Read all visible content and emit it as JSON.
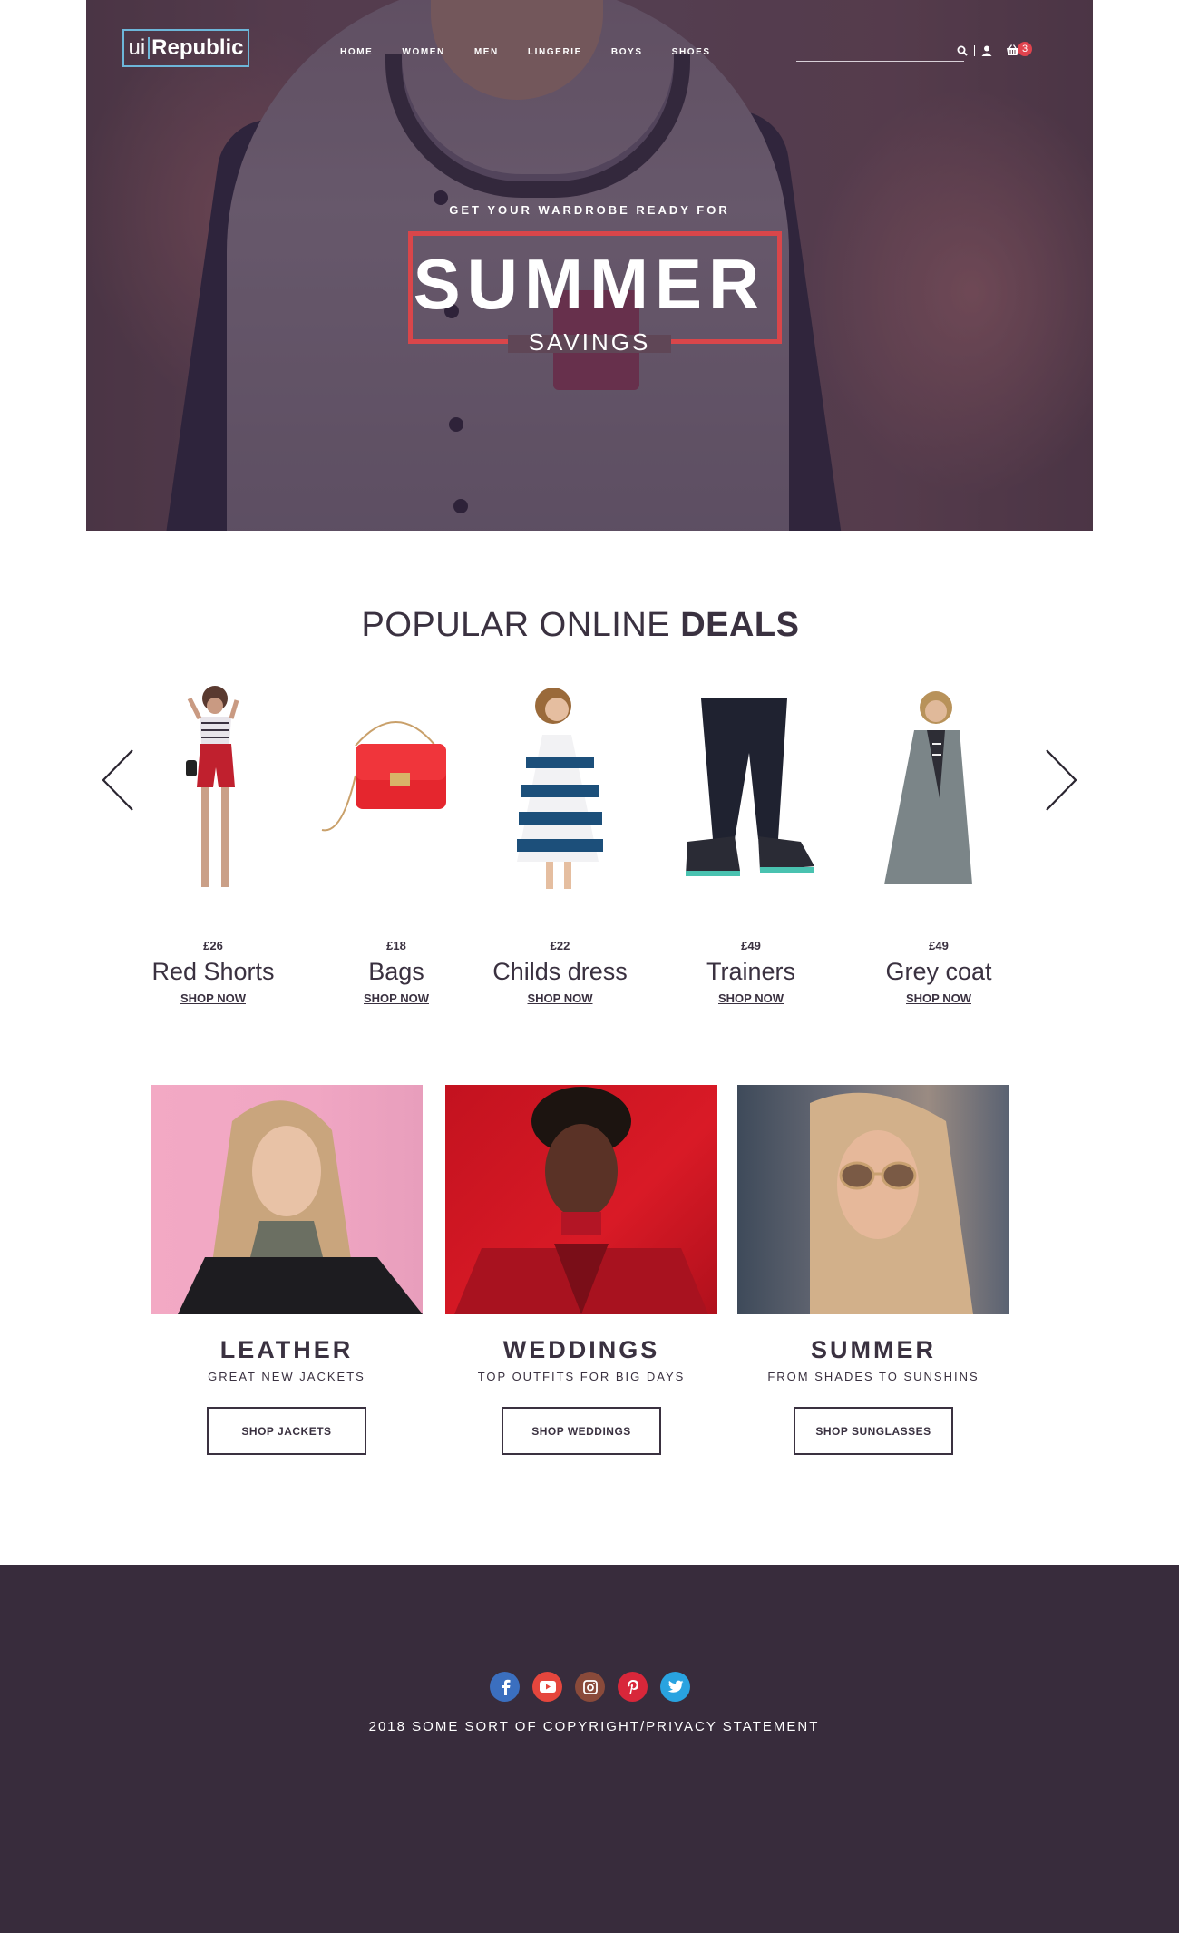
{
  "header": {
    "logo_ui": "ui",
    "logo_republic": "Republic",
    "nav": [
      "HOME",
      "WOMEN",
      "MEN",
      "LINGERIE",
      "BOYS",
      "SHOES"
    ],
    "cart_count": "3",
    "icons": [
      "search-icon",
      "user-icon",
      "cart-icon"
    ]
  },
  "hero": {
    "kicker": "GET YOUR WARDROBE READY FOR",
    "title": "SUMMER",
    "subtitle": "SAVINGS",
    "accent_color": "#d9464a"
  },
  "deals": {
    "title_light": "POPULAR ONLINE ",
    "title_bold": "DEALS",
    "products": [
      {
        "price": "£26",
        "name": "Red Shorts",
        "cta": "SHOP NOW"
      },
      {
        "price": "£18",
        "name": "Bags",
        "cta": "SHOP NOW"
      },
      {
        "price": "£22",
        "name": "Childs dress",
        "cta": "SHOP NOW"
      },
      {
        "price": "£49",
        "name": "Trainers",
        "cta": "SHOP NOW"
      },
      {
        "price": "£49",
        "name": "Grey coat",
        "cta": "SHOP NOW"
      }
    ]
  },
  "categories": [
    {
      "title": "LEATHER",
      "subtitle": "GREAT NEW JACKETS",
      "button": "SHOP JACKETS"
    },
    {
      "title": "WEDDINGS",
      "subtitle": "TOP OUTFITS FOR BIG DAYS",
      "button": "SHOP WEDDINGS"
    },
    {
      "title": "SUMMER",
      "subtitle": "FROM SHADES TO SUNSHINS",
      "button": "SHOP SUNGLASSES"
    }
  ],
  "footer": {
    "social": [
      {
        "icon": "facebook-icon",
        "color": "#3b6fbf"
      },
      {
        "icon": "youtube-icon",
        "color": "#e5463d"
      },
      {
        "icon": "instagram-icon",
        "color": "#8a4a3a"
      },
      {
        "icon": "pinterest-icon",
        "color": "#d8273a"
      },
      {
        "icon": "twitter-icon",
        "color": "#29a3e0"
      }
    ],
    "copyright": "2018 SOME SORT OF COPYRIGHT/PRIVACY STATEMENT",
    "background": "#382c3c"
  }
}
